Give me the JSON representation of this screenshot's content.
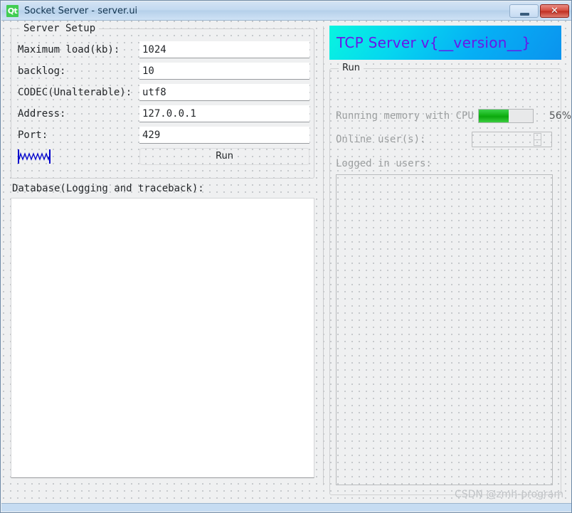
{
  "window": {
    "title": "Socket Server - server.ui",
    "app_icon": "qt-logo-icon",
    "logo_text": "Qt",
    "minimize_label": "–",
    "close_label": "✕"
  },
  "server_setup": {
    "group_title": "Server Setup",
    "rows": [
      {
        "label": "Maximum load(kb):",
        "value": "1024"
      },
      {
        "label": "backlog:",
        "value": "10"
      },
      {
        "label": "CODEC(Unalterable):",
        "value": "utf8"
      },
      {
        "label": "Address:",
        "value": "127.0.0.1"
      },
      {
        "label": "Port:",
        "value": "429"
      }
    ],
    "spacer_name": "horizontal-spacer",
    "run_button": "Run"
  },
  "database": {
    "label": "Database(Logging and traceback):",
    "content": ""
  },
  "banner": {
    "text": "TCP Server v{__version__}",
    "gradient_start": "#08f5e0",
    "gradient_end": "#0b93ee",
    "text_color": "#6a16e8"
  },
  "run_panel": {
    "group_title": "Run",
    "memory_label": "Running memory with CPU",
    "memory_percent_text": "56%",
    "memory_percent_value": 56,
    "progress_color": "#13b316",
    "online_label": "Online user(s):",
    "online_value": "",
    "logged_label": "Logged in users:",
    "logged_users": []
  },
  "watermark": {
    "text": "CSDN @zmh-program"
  }
}
